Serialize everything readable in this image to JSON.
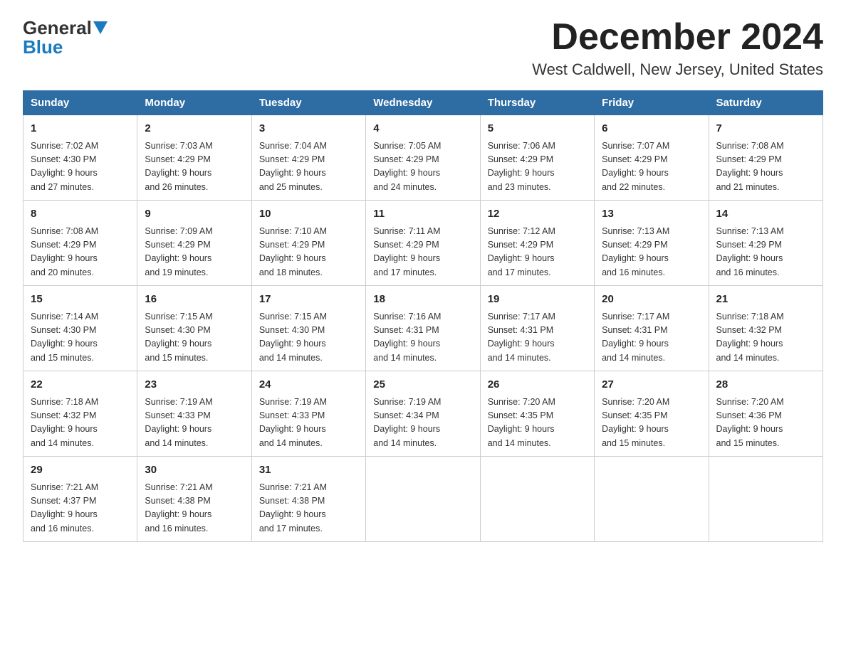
{
  "logo": {
    "general": "General",
    "blue": "Blue"
  },
  "header": {
    "month": "December 2024",
    "location": "West Caldwell, New Jersey, United States"
  },
  "weekdays": [
    "Sunday",
    "Monday",
    "Tuesday",
    "Wednesday",
    "Thursday",
    "Friday",
    "Saturday"
  ],
  "weeks": [
    [
      {
        "day": "1",
        "sunrise": "7:02 AM",
        "sunset": "4:30 PM",
        "daylight": "9 hours and 27 minutes."
      },
      {
        "day": "2",
        "sunrise": "7:03 AM",
        "sunset": "4:29 PM",
        "daylight": "9 hours and 26 minutes."
      },
      {
        "day": "3",
        "sunrise": "7:04 AM",
        "sunset": "4:29 PM",
        "daylight": "9 hours and 25 minutes."
      },
      {
        "day": "4",
        "sunrise": "7:05 AM",
        "sunset": "4:29 PM",
        "daylight": "9 hours and 24 minutes."
      },
      {
        "day": "5",
        "sunrise": "7:06 AM",
        "sunset": "4:29 PM",
        "daylight": "9 hours and 23 minutes."
      },
      {
        "day": "6",
        "sunrise": "7:07 AM",
        "sunset": "4:29 PM",
        "daylight": "9 hours and 22 minutes."
      },
      {
        "day": "7",
        "sunrise": "7:08 AM",
        "sunset": "4:29 PM",
        "daylight": "9 hours and 21 minutes."
      }
    ],
    [
      {
        "day": "8",
        "sunrise": "7:08 AM",
        "sunset": "4:29 PM",
        "daylight": "9 hours and 20 minutes."
      },
      {
        "day": "9",
        "sunrise": "7:09 AM",
        "sunset": "4:29 PM",
        "daylight": "9 hours and 19 minutes."
      },
      {
        "day": "10",
        "sunrise": "7:10 AM",
        "sunset": "4:29 PM",
        "daylight": "9 hours and 18 minutes."
      },
      {
        "day": "11",
        "sunrise": "7:11 AM",
        "sunset": "4:29 PM",
        "daylight": "9 hours and 17 minutes."
      },
      {
        "day": "12",
        "sunrise": "7:12 AM",
        "sunset": "4:29 PM",
        "daylight": "9 hours and 17 minutes."
      },
      {
        "day": "13",
        "sunrise": "7:13 AM",
        "sunset": "4:29 PM",
        "daylight": "9 hours and 16 minutes."
      },
      {
        "day": "14",
        "sunrise": "7:13 AM",
        "sunset": "4:29 PM",
        "daylight": "9 hours and 16 minutes."
      }
    ],
    [
      {
        "day": "15",
        "sunrise": "7:14 AM",
        "sunset": "4:30 PM",
        "daylight": "9 hours and 15 minutes."
      },
      {
        "day": "16",
        "sunrise": "7:15 AM",
        "sunset": "4:30 PM",
        "daylight": "9 hours and 15 minutes."
      },
      {
        "day": "17",
        "sunrise": "7:15 AM",
        "sunset": "4:30 PM",
        "daylight": "9 hours and 14 minutes."
      },
      {
        "day": "18",
        "sunrise": "7:16 AM",
        "sunset": "4:31 PM",
        "daylight": "9 hours and 14 minutes."
      },
      {
        "day": "19",
        "sunrise": "7:17 AM",
        "sunset": "4:31 PM",
        "daylight": "9 hours and 14 minutes."
      },
      {
        "day": "20",
        "sunrise": "7:17 AM",
        "sunset": "4:31 PM",
        "daylight": "9 hours and 14 minutes."
      },
      {
        "day": "21",
        "sunrise": "7:18 AM",
        "sunset": "4:32 PM",
        "daylight": "9 hours and 14 minutes."
      }
    ],
    [
      {
        "day": "22",
        "sunrise": "7:18 AM",
        "sunset": "4:32 PM",
        "daylight": "9 hours and 14 minutes."
      },
      {
        "day": "23",
        "sunrise": "7:19 AM",
        "sunset": "4:33 PM",
        "daylight": "9 hours and 14 minutes."
      },
      {
        "day": "24",
        "sunrise": "7:19 AM",
        "sunset": "4:33 PM",
        "daylight": "9 hours and 14 minutes."
      },
      {
        "day": "25",
        "sunrise": "7:19 AM",
        "sunset": "4:34 PM",
        "daylight": "9 hours and 14 minutes."
      },
      {
        "day": "26",
        "sunrise": "7:20 AM",
        "sunset": "4:35 PM",
        "daylight": "9 hours and 14 minutes."
      },
      {
        "day": "27",
        "sunrise": "7:20 AM",
        "sunset": "4:35 PM",
        "daylight": "9 hours and 15 minutes."
      },
      {
        "day": "28",
        "sunrise": "7:20 AM",
        "sunset": "4:36 PM",
        "daylight": "9 hours and 15 minutes."
      }
    ],
    [
      {
        "day": "29",
        "sunrise": "7:21 AM",
        "sunset": "4:37 PM",
        "daylight": "9 hours and 16 minutes."
      },
      {
        "day": "30",
        "sunrise": "7:21 AM",
        "sunset": "4:38 PM",
        "daylight": "9 hours and 16 minutes."
      },
      {
        "day": "31",
        "sunrise": "7:21 AM",
        "sunset": "4:38 PM",
        "daylight": "9 hours and 17 minutes."
      },
      null,
      null,
      null,
      null
    ]
  ],
  "labels": {
    "sunrise": "Sunrise:",
    "sunset": "Sunset:",
    "daylight": "Daylight:"
  }
}
